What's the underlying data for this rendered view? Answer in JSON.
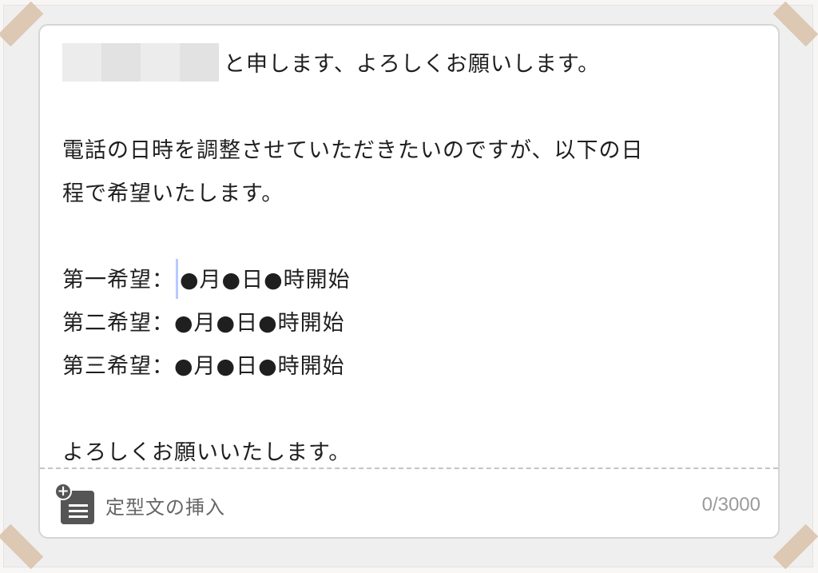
{
  "message": {
    "line1_suffix": "と申します、よろしくお願いします。",
    "line3": "電話の日時を調整させていただきたいのですが、以下の日",
    "line4": "程で希望いたします。",
    "pref1_label": "第一希望：",
    "pref1_value": "●月●日●時開始",
    "pref2": "第二希望：●月●日●時開始",
    "pref3": "第三希望：●月●日●時開始",
    "closing": "よろしくお願いいたします。"
  },
  "footer": {
    "insert_template_label": "定型文の挿入",
    "template_icon": "document-plus-icon",
    "char_count": "0/3000"
  },
  "colors": {
    "caret": "#b8c9ff",
    "icon": "#555555"
  }
}
